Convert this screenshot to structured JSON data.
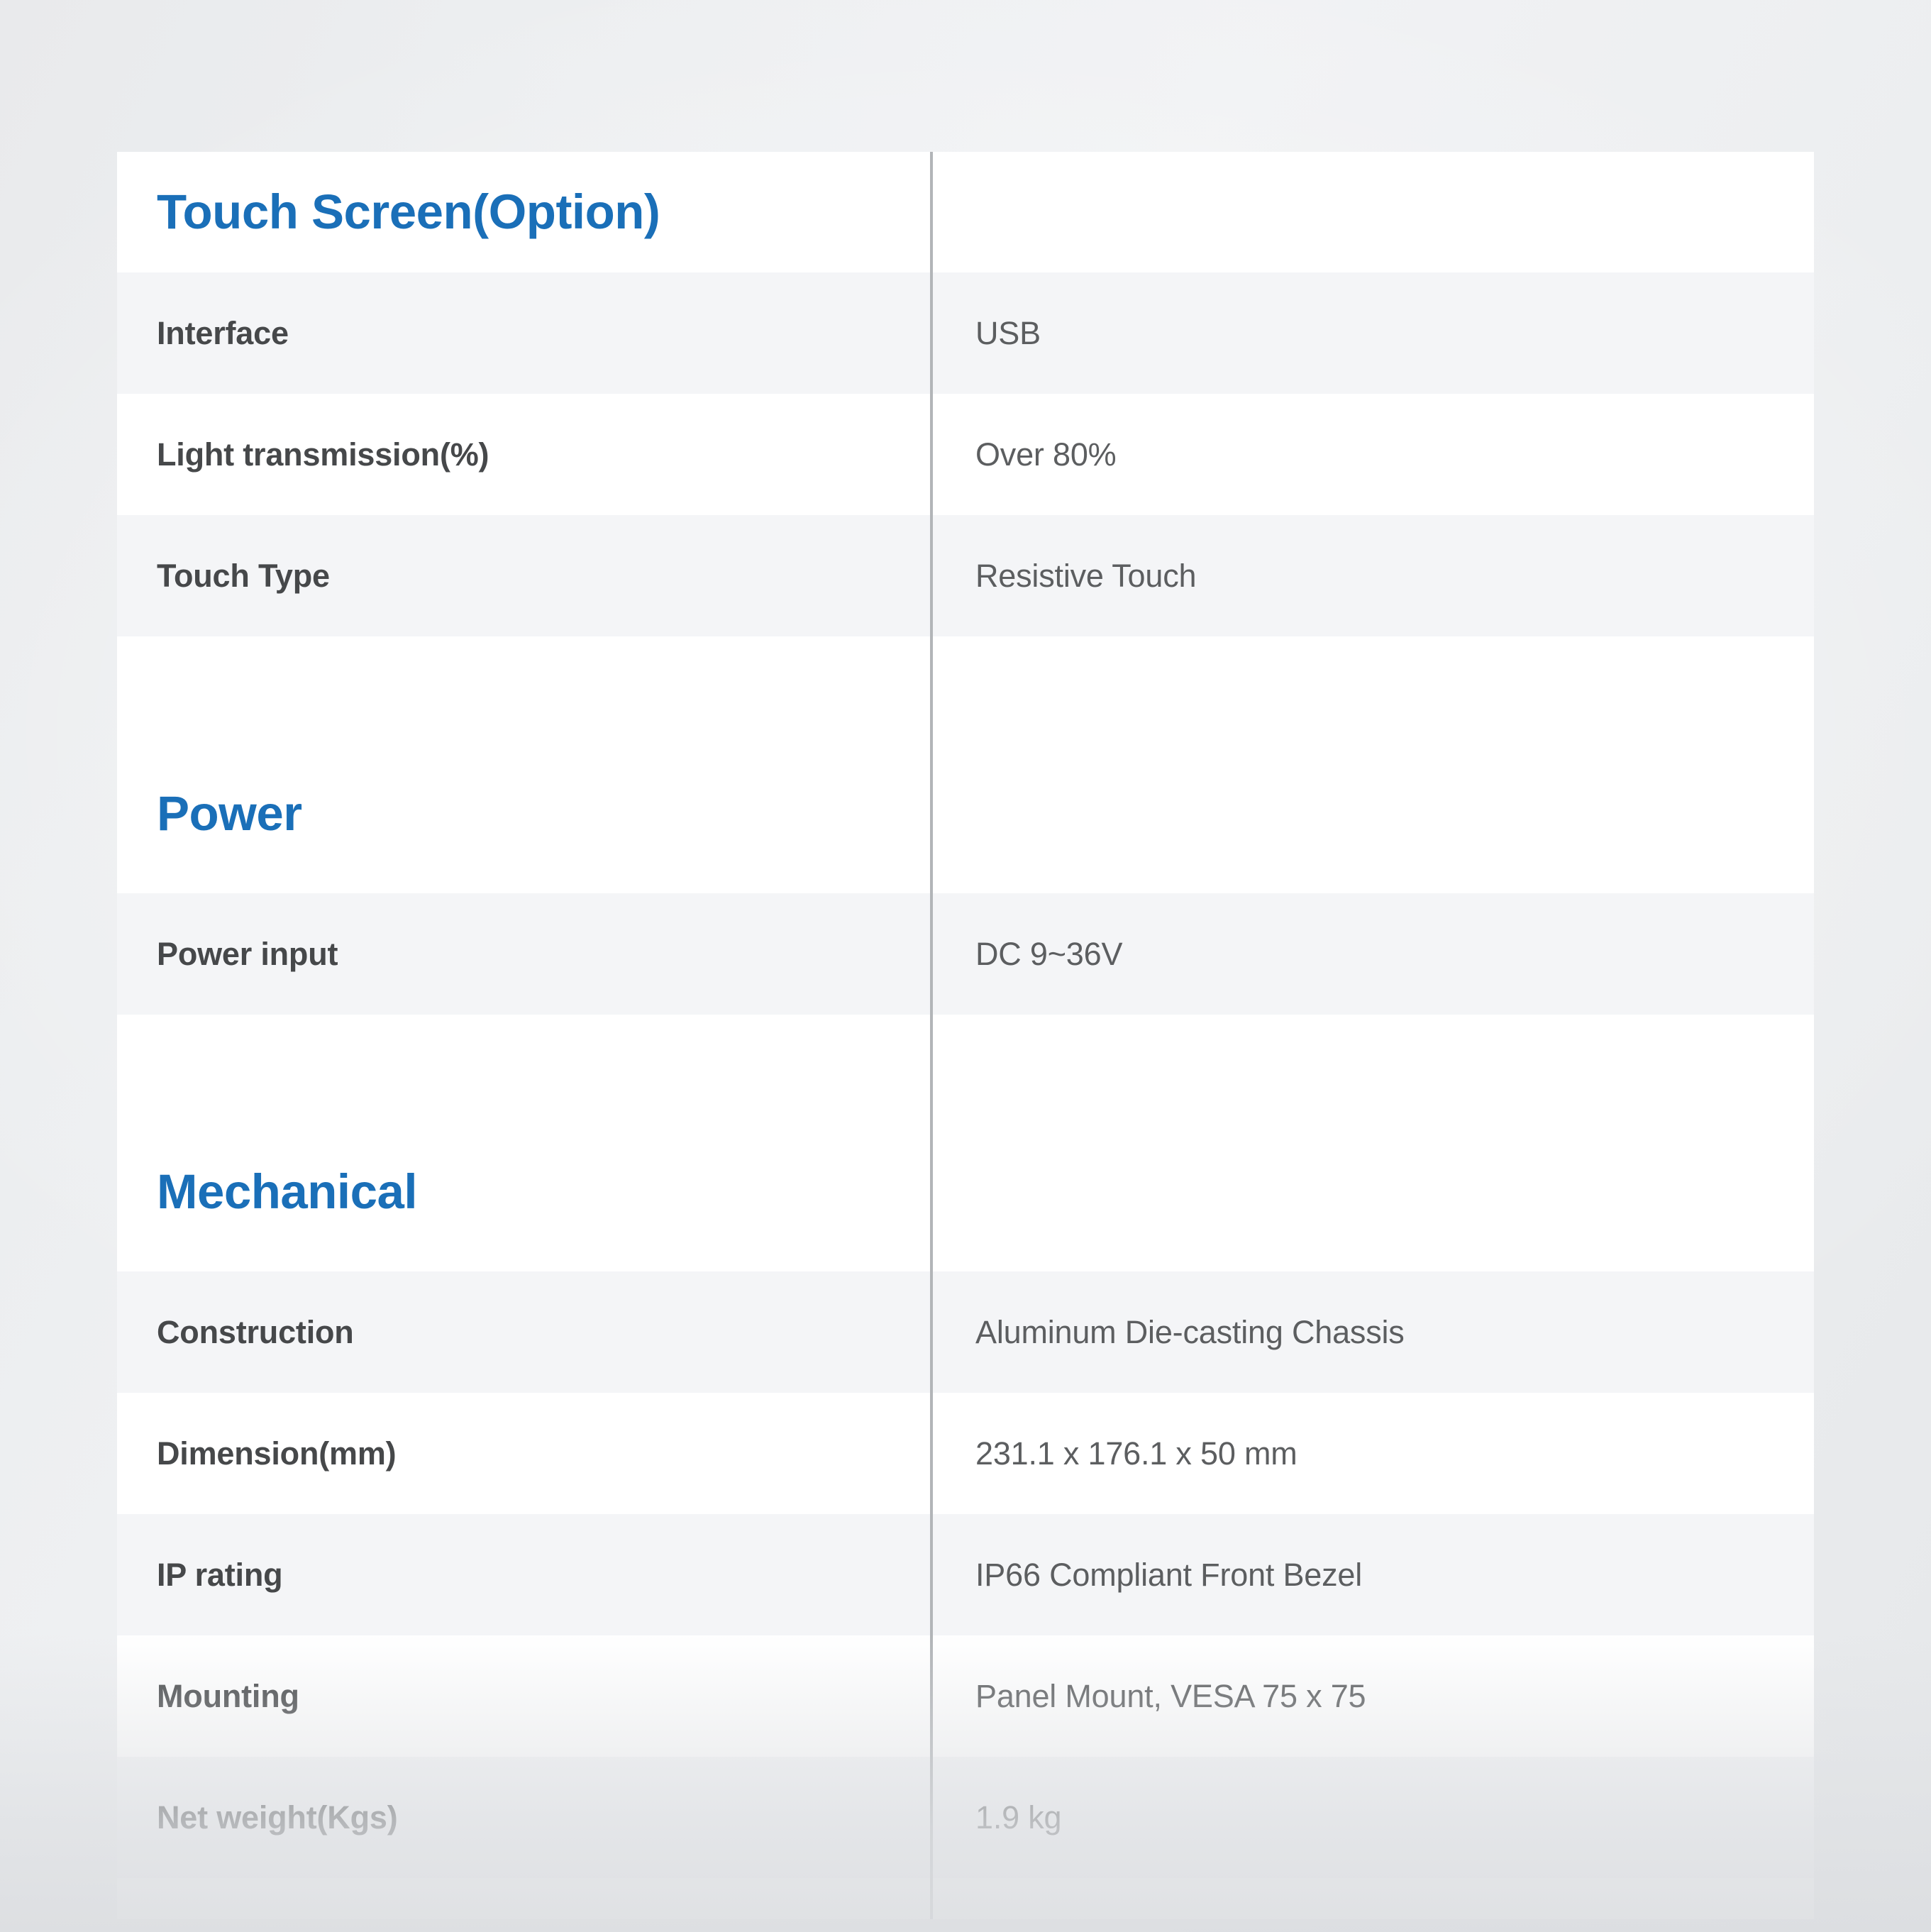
{
  "document": {
    "kind": "product-specification-table",
    "accent_color": "#1a6fb8",
    "label_color": "#46484a",
    "value_color": "#5c5e60",
    "row_alt_color": "#f4f5f7",
    "row_base_color": "#ffffff",
    "divider_color": "#b2b5b8"
  },
  "sections": [
    {
      "title": "Touch Screen(Option)",
      "rows": [
        {
          "label": "Interface",
          "value": "USB"
        },
        {
          "label": "Light transmission(%)",
          "value": "Over 80%"
        },
        {
          "label": "Touch Type",
          "value": "Resistive Touch"
        }
      ]
    },
    {
      "title": "Power",
      "rows": [
        {
          "label": "Power input",
          "value": "DC 9~36V"
        }
      ]
    },
    {
      "title": "Mechanical",
      "rows": [
        {
          "label": "Construction",
          "value": "Aluminum Die-casting Chassis"
        },
        {
          "label": "Dimension(mm)",
          "value": "231.1 x 176.1 x 50 mm"
        },
        {
          "label": "IP rating",
          "value": "IP66 Compliant Front Bezel"
        },
        {
          "label": "Mounting",
          "value": "Panel Mount, VESA 75 x 75"
        },
        {
          "label": "Net weight(Kgs)",
          "value": "1.9 kg"
        }
      ]
    }
  ]
}
